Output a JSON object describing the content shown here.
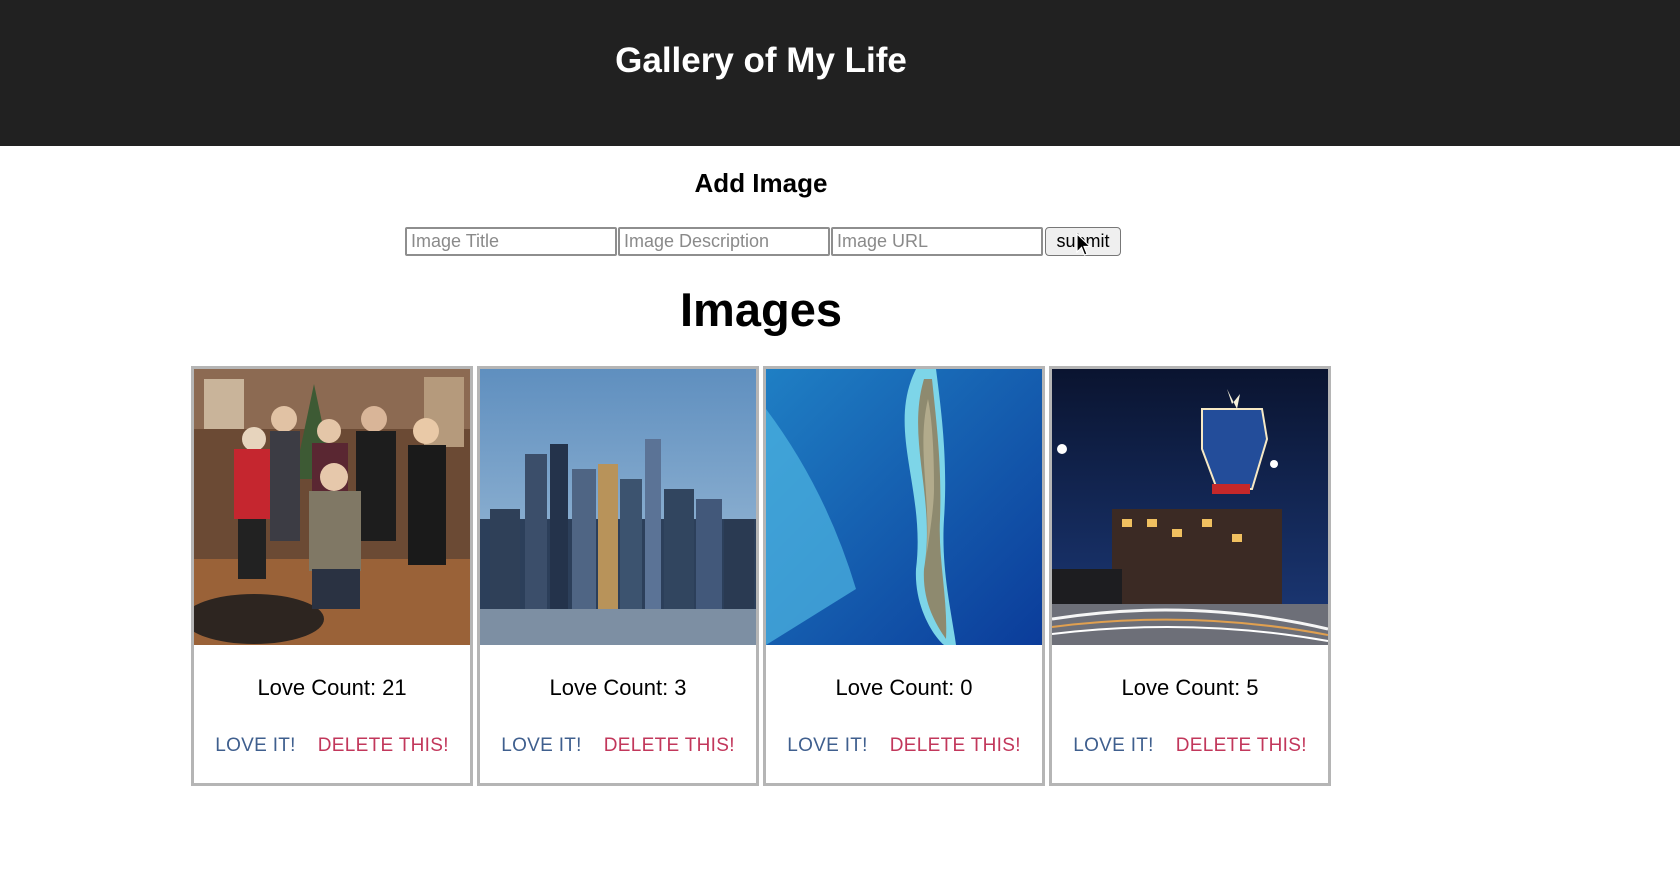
{
  "header": {
    "title": "Gallery of My Life"
  },
  "add_form": {
    "heading": "Add Image",
    "title_placeholder": "Image Title",
    "description_placeholder": "Image Description",
    "url_placeholder": "Image URL",
    "submit_label": "submit"
  },
  "images_section": {
    "heading": "Images",
    "love_count_label": "Love Count:",
    "love_button_label": "LOVE IT!",
    "delete_button_label": "DELETE THIS!",
    "items": [
      {
        "love_count": "21"
      },
      {
        "love_count": "3"
      },
      {
        "love_count": "0"
      },
      {
        "love_count": "5"
      }
    ]
  },
  "colors": {
    "header_bg": "#212121",
    "love_button": "#3f5f8e",
    "delete_button": "#c2375b"
  },
  "icons": {
    "cursor": "arrow-cursor-icon"
  }
}
